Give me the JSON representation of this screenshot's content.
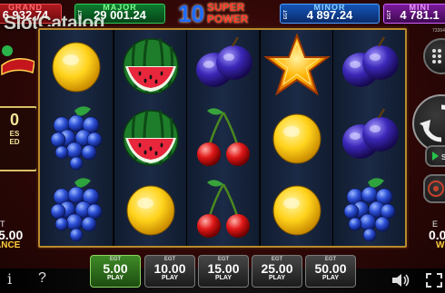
{
  "jackpots": {
    "grand": {
      "label": "GRAND",
      "value": "6 932.74"
    },
    "major": {
      "label": "MAJOR",
      "value": "29 001.24"
    },
    "minor": {
      "label": "MINOR",
      "value": "4 897.24"
    },
    "mini": {
      "label": "MINI",
      "value": "4 781.1"
    },
    "egt": "EGT"
  },
  "logo": {
    "number": "10",
    "line1": "SUPER",
    "line2": "POWER"
  },
  "watermark": "SlotCatalog",
  "left_panel": {
    "badge_value": "0",
    "badge_line1": "ES",
    "badge_line2": "ED",
    "bet_label": "T",
    "bet_value": "5.00",
    "balance_label": "ANCE"
  },
  "right_panel": {
    "game_id": "73364",
    "win_label": "E",
    "win_value": "0.0",
    "win_sub": "W",
    "auto_label": "SP"
  },
  "reels": [
    [
      "lemon",
      "grapes",
      "grapes"
    ],
    [
      "watermelon",
      "watermelon",
      "lemon"
    ],
    [
      "plum",
      "cherries",
      "cherries"
    ],
    [
      "star",
      "lemon",
      "lemon"
    ],
    [
      "plum",
      "plum",
      "grapes"
    ]
  ],
  "bets": [
    {
      "brand": "EGT",
      "value": "5.00",
      "play": "PLAY",
      "active": true
    },
    {
      "brand": "EGT",
      "value": "10.00",
      "play": "PLAY",
      "active": false
    },
    {
      "brand": "EGT",
      "value": "15.00",
      "play": "PLAY",
      "active": false
    },
    {
      "brand": "EGT",
      "value": "25.00",
      "play": "PLAY",
      "active": false
    },
    {
      "brand": "EGT",
      "value": "50.00",
      "play": "PLAY",
      "active": false
    }
  ],
  "bottom": {
    "info": "i",
    "help": "?"
  },
  "colors": {
    "active_bet": "#3f8a27",
    "frame_gold": "#b98a2c",
    "balance_yellow": "#ffcf3d"
  }
}
